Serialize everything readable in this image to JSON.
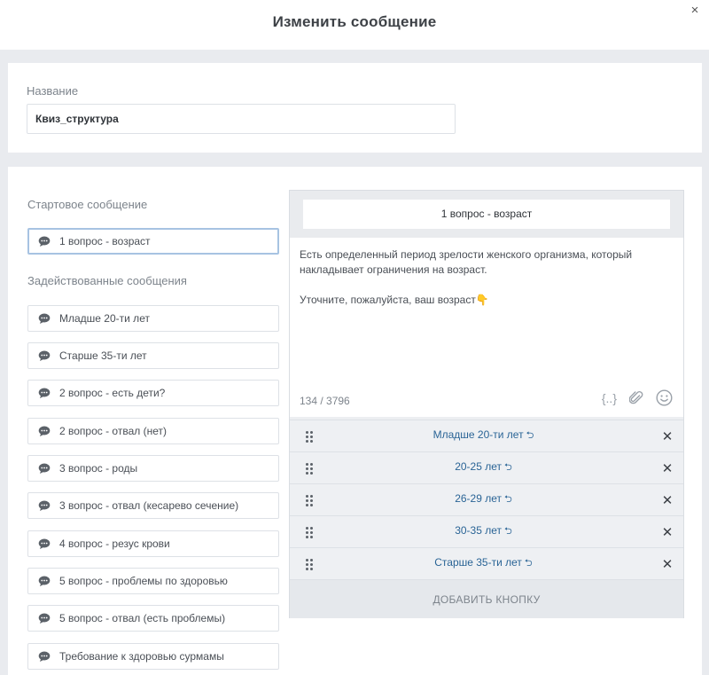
{
  "header": {
    "title": "Изменить сообщение",
    "close_symbol": "×"
  },
  "name_section": {
    "label": "Название",
    "value": "Квиз_структура"
  },
  "start_section": {
    "label": "Стартовое сообщение",
    "message": "1 вопрос - возраст"
  },
  "used_section": {
    "label": "Задействованные сообщения",
    "items": [
      "Младше 20-ти лет",
      "Старше 35-ти лет",
      "2 вопрос - есть дети?",
      "2 вопрос - отвал (нет)",
      "3 вопрос - роды",
      "3 вопрос - отвал (кесарево сечение)",
      "4 вопрос - резус крови",
      "5 вопрос - проблемы по здоровью",
      "5 вопрос - отвал (есть проблемы)",
      "Требование к здоровью сурмамы"
    ]
  },
  "editor": {
    "message_name": "1 вопрос - возраст",
    "text_line1": "Есть определенный период зрелости женского организма, который накладывает ограничения на возраст.",
    "text_line2": "Уточните, пожалуйста, ваш возраст👇",
    "counter": "134 / 3796",
    "tools": [
      "variables-icon",
      "attachment-icon",
      "emoji-icon"
    ],
    "variables_symbol": "{..}",
    "buttons": [
      "Младше 20-ти лет",
      "20-25 лет",
      "26-29 лет",
      "30-35 лет",
      "Старше 35-ти лет"
    ],
    "button_arrow": "⮌",
    "remove_symbol": "✕",
    "add_button": "ДОБАВИТЬ КНОПКУ"
  },
  "colors": {
    "link": "#2a6496",
    "active_border": "#a7c3e2",
    "background": "#e9ebef"
  }
}
